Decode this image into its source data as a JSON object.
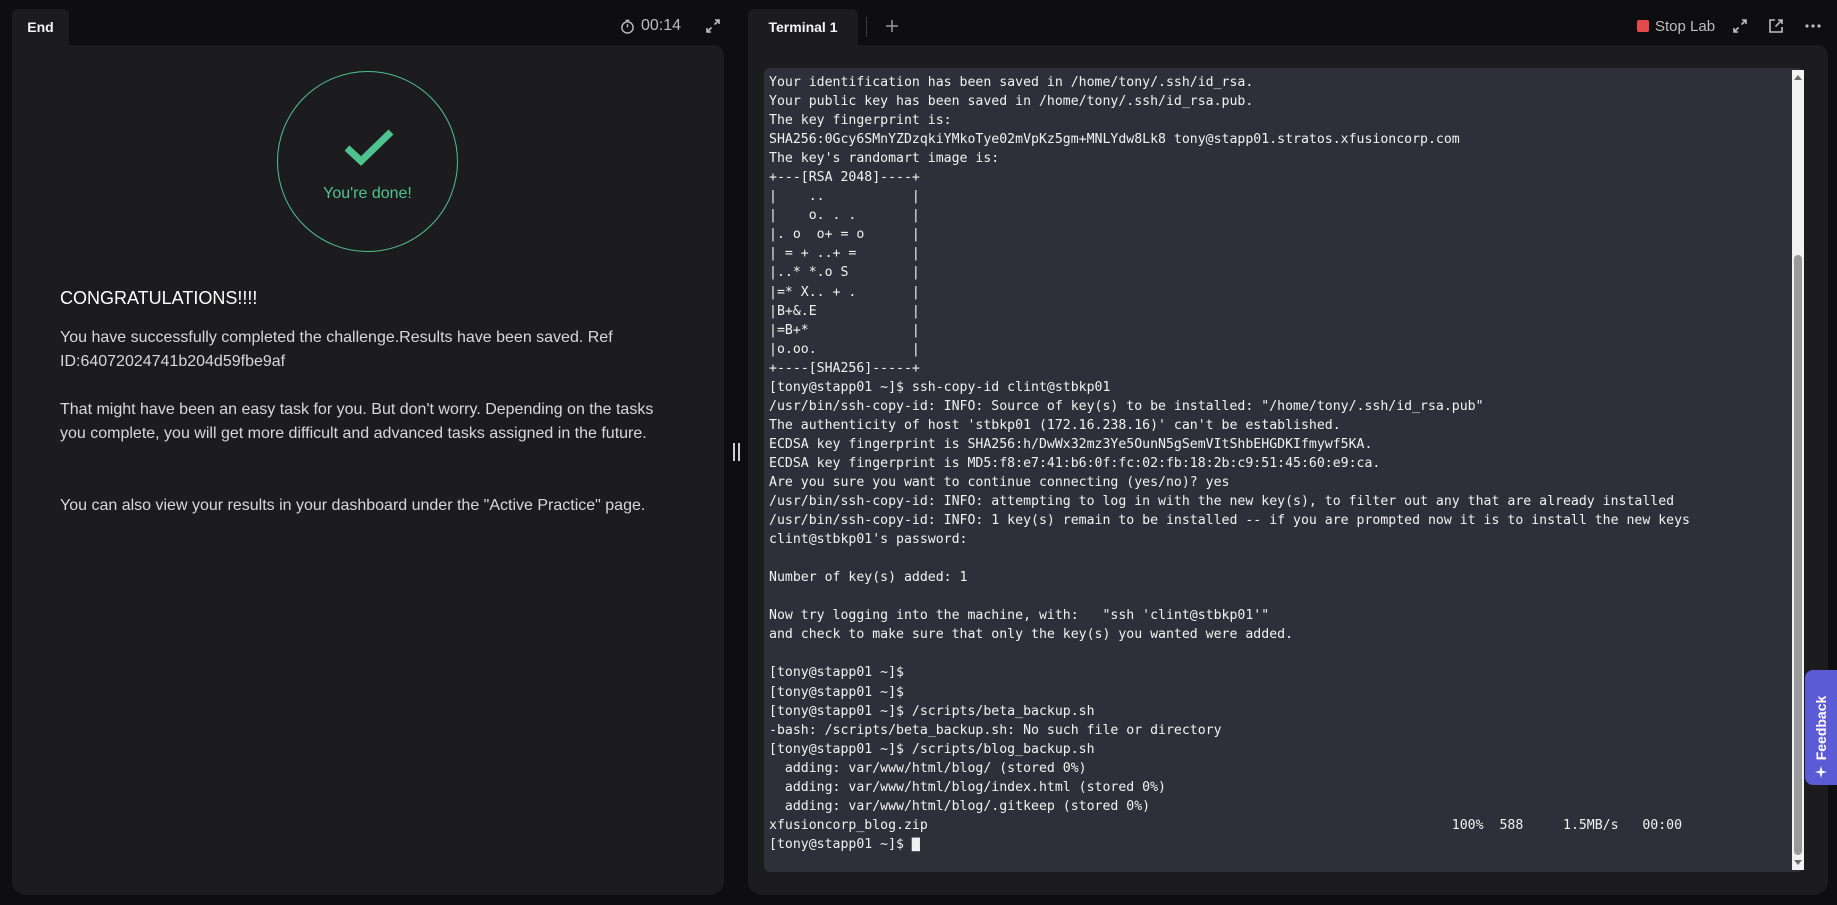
{
  "left_panel": {
    "tab_label": "End",
    "timer": "00:14",
    "done_text": "You're done!",
    "heading": "CONGRATULATIONS!!!!",
    "paragraph_1": "You have successfully completed the challenge.Results have been saved. Ref ID:64072024741b204d59fbe9af",
    "paragraph_2": "That might have been an easy task for you. But don't worry. Depending on the tasks you complete, you will get more difficult and advanced tasks assigned in the future.",
    "paragraph_3": "You can also view your results in your dashboard under the \"Active Practice\" page."
  },
  "right_panel": {
    "tab_label": "Terminal 1",
    "stop_lab_label": "Stop Lab"
  },
  "terminal": {
    "lines": [
      "Your identification has been saved in /home/tony/.ssh/id_rsa.",
      "Your public key has been saved in /home/tony/.ssh/id_rsa.pub.",
      "The key fingerprint is:",
      "SHA256:0Gcy6SMnYZDzqkiYMkoTye02mVpKz5gm+MNLYdw8Lk8 tony@stapp01.stratos.xfusioncorp.com",
      "The key's randomart image is:",
      "+---[RSA 2048]----+",
      "|    ..           |",
      "|    o. . .       |",
      "|. o  o+ = o      |",
      "| = + ..+ =       |",
      "|..* *.o S        |",
      "|=* X.. + .       |",
      "|B+&.E            |",
      "|=B+*             |",
      "|o.oo.            |",
      "+----[SHA256]-----+",
      "[tony@stapp01 ~]$ ssh-copy-id clint@stbkp01",
      "/usr/bin/ssh-copy-id: INFO: Source of key(s) to be installed: \"/home/tony/.ssh/id_rsa.pub\"",
      "The authenticity of host 'stbkp01 (172.16.238.16)' can't be established.",
      "ECDSA key fingerprint is SHA256:h/DwWx32mz3Ye5OunN5gSemVItShbEHGDKIfmywf5KA.",
      "ECDSA key fingerprint is MD5:f8:e7:41:b6:0f:fc:02:fb:18:2b:c9:51:45:60:e9:ca.",
      "Are you sure you want to continue connecting (yes/no)? yes",
      "/usr/bin/ssh-copy-id: INFO: attempting to log in with the new key(s), to filter out any that are already installed",
      "/usr/bin/ssh-copy-id: INFO: 1 key(s) remain to be installed -- if you are prompted now it is to install the new keys",
      "clint@stbkp01's password:",
      "",
      "Number of key(s) added: 1",
      "",
      "Now try logging into the machine, with:   \"ssh 'clint@stbkp01'\"",
      "and check to make sure that only the key(s) you wanted were added.",
      "",
      "[tony@stapp01 ~]$",
      "[tony@stapp01 ~]$",
      "[tony@stapp01 ~]$ /scripts/beta_backup.sh",
      "-bash: /scripts/beta_backup.sh: No such file or directory",
      "[tony@stapp01 ~]$ /scripts/blog_backup.sh",
      "  adding: var/www/html/blog/ (stored 0%)",
      "  adding: var/www/html/blog/index.html (stored 0%)",
      "  adding: var/www/html/blog/.gitkeep (stored 0%)",
      "xfusioncorp_blog.zip                                                                  100%  588     1.5MB/s   00:00",
      "[tony@stapp01 ~]$ ▇"
    ]
  },
  "feedback": {
    "label": "Feedback"
  },
  "colors": {
    "accent_green": "#4fc38e",
    "terminal_bg": "#2e3039",
    "panel_bg": "#1c1c1f",
    "stop_red": "#e5484d",
    "feedback_purple": "#5b5bd6"
  },
  "icons": [
    "stopwatch-icon",
    "expand-icon",
    "check-icon",
    "plus-icon",
    "stop-icon",
    "fullscreen-icon",
    "external-link-icon",
    "more-icon",
    "sparkle-icon"
  ]
}
